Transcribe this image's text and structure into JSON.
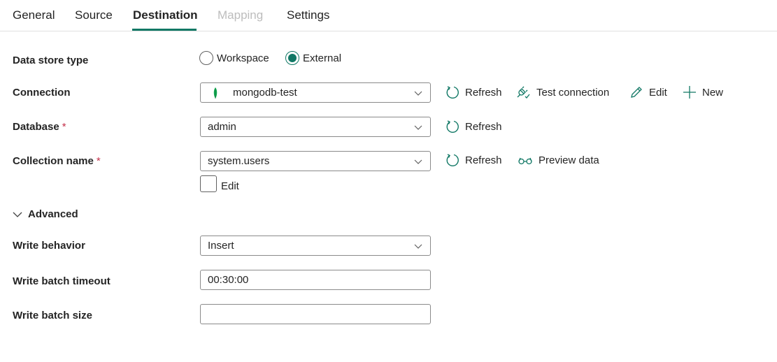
{
  "tabs": [
    {
      "label": "General",
      "state": "normal"
    },
    {
      "label": "Source",
      "state": "normal"
    },
    {
      "label": "Destination",
      "state": "active"
    },
    {
      "label": "Mapping",
      "state": "disabled"
    },
    {
      "label": "Settings",
      "state": "normal"
    }
  ],
  "accent_color": "#117865",
  "form": {
    "data_store_type": {
      "label": "Data store type",
      "options": [
        "Workspace",
        "External"
      ],
      "selected": "External"
    },
    "connection": {
      "label": "Connection",
      "value": "mongodb-test",
      "icon": "mongodb-leaf-icon",
      "actions": {
        "refresh": "Refresh",
        "test_connection": "Test connection",
        "edit": "Edit",
        "new": "New"
      }
    },
    "database": {
      "label": "Database",
      "required": "*",
      "value": "admin",
      "actions": {
        "refresh": "Refresh"
      }
    },
    "collection_name": {
      "label": "Collection name",
      "required": "*",
      "value": "system.users",
      "actions": {
        "refresh": "Refresh",
        "preview": "Preview data"
      },
      "edit_checkbox": {
        "label": "Edit",
        "checked": false
      }
    },
    "advanced": {
      "label": "Advanced",
      "expanded": true
    },
    "write_behavior": {
      "label": "Write behavior",
      "value": "Insert"
    },
    "write_batch_timeout": {
      "label": "Write batch timeout",
      "value": "00:30:00"
    },
    "write_batch_size": {
      "label": "Write batch size",
      "value": ""
    }
  }
}
